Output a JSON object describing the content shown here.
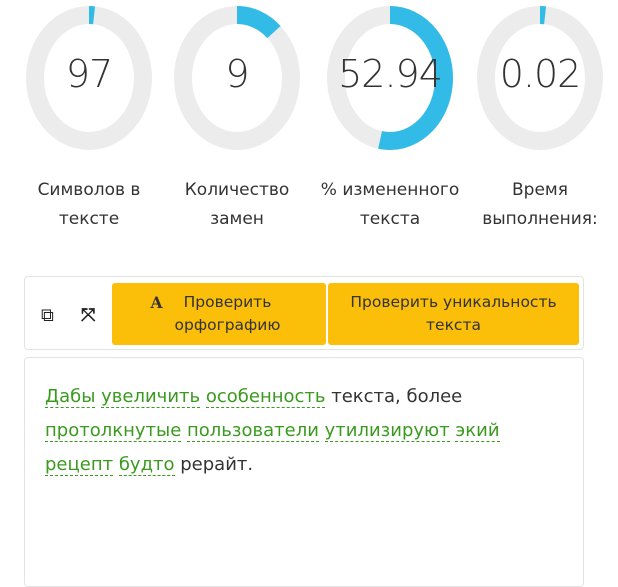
{
  "stats": [
    {
      "value": "97",
      "label": "Символов в тексте",
      "fraction": 0.015
    },
    {
      "value": "9",
      "label": "Количество замен",
      "fraction": 0.12
    },
    {
      "value": "52.94",
      "label": "% измененного текста",
      "fraction": 0.5294
    },
    {
      "value": "0.02",
      "label": "Время выполнения:",
      "fraction": 0.015
    }
  ],
  "colors": {
    "ring_fill": "#33bbe8",
    "ring_track": "#ececec",
    "button": "#fbbf0a",
    "changed_word": "#3a9a1e"
  },
  "toolbar": {
    "copy_icon": "copy-icon",
    "expand_icon": "expand-icon",
    "spell_icon_glyph": "A",
    "spell_label": "Проверить орфографию",
    "unique_label": "Проверить уникальность текста"
  },
  "editor": {
    "segments": [
      {
        "t": "Дабы",
        "c": true
      },
      {
        "t": " ",
        "c": false
      },
      {
        "t": "увеличить",
        "c": true
      },
      {
        "t": " ",
        "c": false
      },
      {
        "t": "особенность",
        "c": true
      },
      {
        "t": " текста, более ",
        "c": false
      },
      {
        "t": "протолкнутые",
        "c": true
      },
      {
        "t": " ",
        "c": false
      },
      {
        "t": "пользователи",
        "c": true
      },
      {
        "t": " ",
        "c": false
      },
      {
        "t": "утилизируют",
        "c": true
      },
      {
        "t": " ",
        "c": false
      },
      {
        "t": "экий",
        "c": true
      },
      {
        "t": " ",
        "c": false
      },
      {
        "t": "рецепт",
        "c": true
      },
      {
        "t": " ",
        "c": false
      },
      {
        "t": "будто",
        "c": true
      },
      {
        "t": " рерайт.",
        "c": false
      }
    ]
  }
}
